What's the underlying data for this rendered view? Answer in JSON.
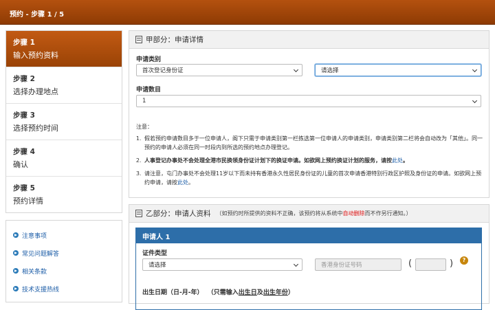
{
  "header": {
    "title": "预约 - 步骤 1 / 5"
  },
  "steps": [
    {
      "num": "步骤 1",
      "label": "输入预约资料",
      "active": true
    },
    {
      "num": "步骤 2",
      "label": "选择办理地点"
    },
    {
      "num": "步骤 3",
      "label": "选择预约时间"
    },
    {
      "num": "步骤 4",
      "label": "确认"
    },
    {
      "num": "步骤 5",
      "label": "预约详情"
    }
  ],
  "links": [
    "注意事项",
    "常见问题解答",
    "相关条款",
    "技术支援热线"
  ],
  "partA": {
    "title": "甲部分：申请详情",
    "category_label": "申请类别",
    "category_value": "首次登记身份证",
    "category2_value": "请选择",
    "count_label": "申请数目",
    "count_value": "1",
    "notes_title": "注意：",
    "note1": "假若预约申请数目多于一位申请人，阁下只需于申请类别第一栏拣选第一位申请人的申请类别，申请类别第二栏将会自动改为「其他」。同一预约的申请人必须在同一时段内到所选的预约地点办理登记。",
    "note2_bold": "人事登记办事处不会处理全港市民换领身份证计划下的换证申请。如欲网上预约换证计划的服务，请按",
    "note2_link": "此处",
    "note2_end": "。",
    "note3": "请注意，屯门办事处不会处理11岁以下而未持有香港永久性居民身份证的儿童的首次申请香港特别行政区护照及身份证的申请。如欲网上预约申请，请按",
    "note3_link": "此处",
    "note3_end": "。"
  },
  "partB": {
    "title": "乙部分：申请人资料",
    "note_pre": "（如预约时所提供的资料不正确，该预约将从系统中",
    "note_red": "自动删除",
    "note_post": "而不作另行通知。）",
    "applicant_title": "申请人 1",
    "doc_type_label": "证件类型",
    "doc_type_value": "请选择",
    "id_placeholder": "香港身份证号码",
    "help_glyph": "?",
    "paren_open": "(",
    "paren_close": ")",
    "dob_label": "出生日期（日-月-年）",
    "dob_note_pre": "（只需输入",
    "dob_note_u1": "出生日",
    "dob_note_mid": "及",
    "dob_note_u2": "出生年份",
    "dob_note_post": "）"
  },
  "colors": {
    "header": "#a0460a",
    "applicant_header": "#2d6ea9",
    "link": "#1f5fa8",
    "help": "#c7860c"
  }
}
